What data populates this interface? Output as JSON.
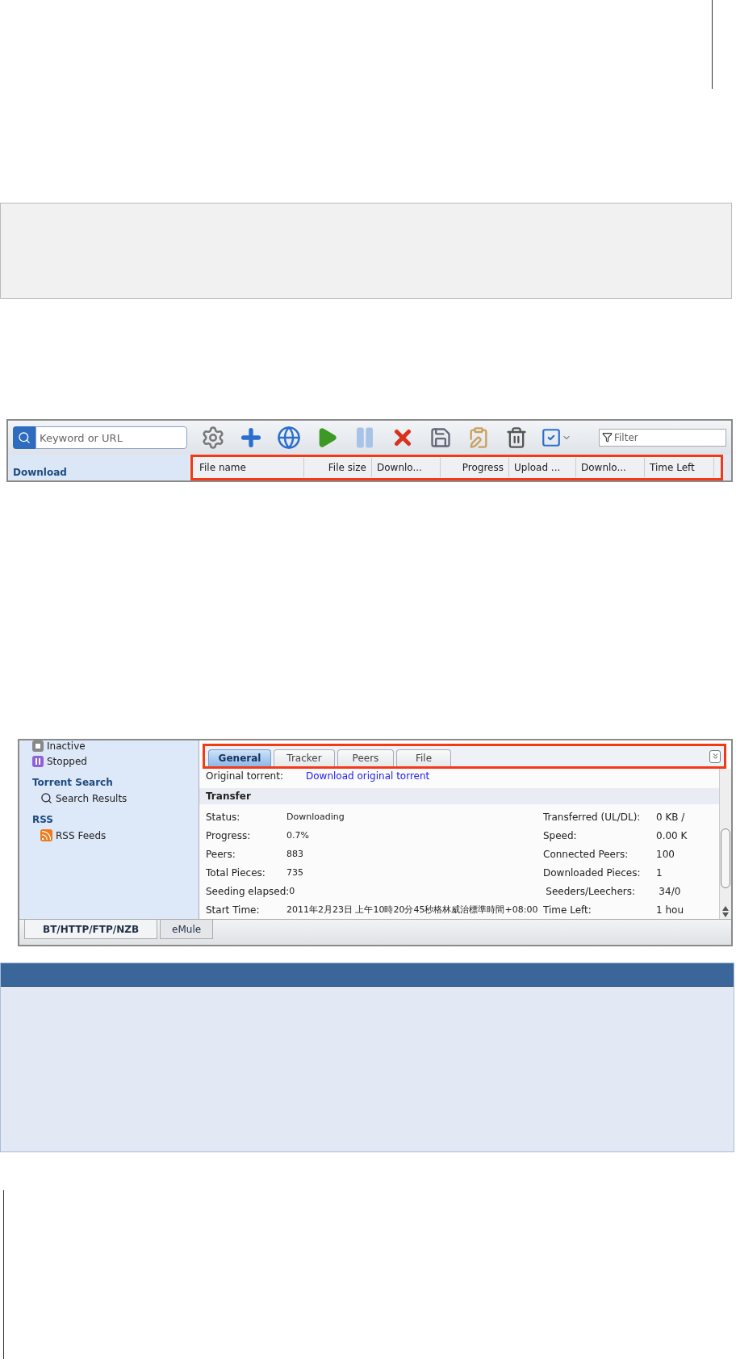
{
  "toolbar": {
    "search": {
      "placeholder": "Keyword or URL"
    },
    "filter": {
      "placeholder": "Filter"
    }
  },
  "download_panel": {
    "sidebar_heading": "Download",
    "columns": [
      "File name",
      "File size",
      "Downlo...",
      "Progress",
      "Upload ...",
      "Downlo...",
      "Time Left"
    ]
  },
  "detail_panel": {
    "sidebar": [
      {
        "items": [
          "Inactive",
          "Stopped"
        ]
      },
      {
        "heading": "Torrent Search",
        "items": [
          "Search Results"
        ]
      },
      {
        "heading": "RSS",
        "items": [
          "RSS Feeds"
        ]
      }
    ],
    "tabs": [
      {
        "label": "General",
        "selected": true
      },
      {
        "label": "Tracker",
        "selected": false
      },
      {
        "label": "Peers",
        "selected": false
      },
      {
        "label": "File",
        "selected": false
      }
    ],
    "original_torrent": {
      "label": "Original torrent:",
      "link": "Download original torrent"
    },
    "section": "Transfer",
    "rows": [
      {
        "label": "Status:",
        "value": "Downloading",
        "label_2": "Transferred (UL/DL):",
        "value_2": "0 KB /"
      },
      {
        "label": "Progress:",
        "value": "0.7%",
        "label_2": "Speed:",
        "value_2": "0.00 K"
      },
      {
        "label": "Peers:",
        "value": "883",
        "label_2": "Connected Peers:",
        "value_2": "100"
      },
      {
        "label": "Total Pieces:",
        "value": "735",
        "label_2": "Downloaded Pieces:",
        "value_2": "1"
      },
      {
        "label": "Seeding elapsed:",
        "value": "0",
        "label_2": "Seeders/Leechers:",
        "value_2": "34/0"
      },
      {
        "label": "Start Time:",
        "value": "2011年2月23日 上午10時20分45秒格林威治標準時間+08:00",
        "label_2": "Time Left:",
        "value_2": "1 hou"
      }
    ],
    "bottom_tabs": [
      {
        "label": "BT/HTTP/FTP/NZB",
        "selected": true
      },
      {
        "label": "eMule",
        "selected": false
      }
    ]
  }
}
